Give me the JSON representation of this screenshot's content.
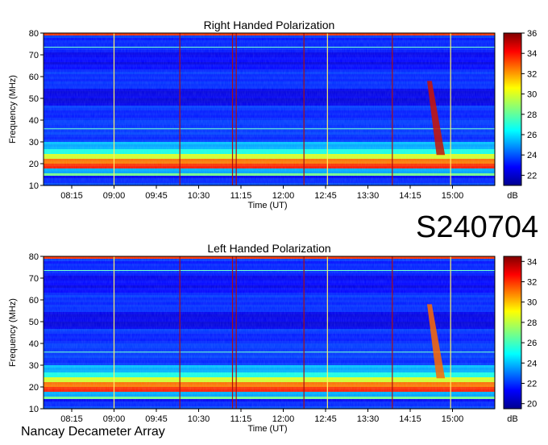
{
  "event_label": "S240704",
  "footer_label": "Nancay Decameter Array",
  "chart_data": [
    {
      "type": "heatmap",
      "title": "Right Handed Polarization",
      "xlabel": "Time (UT)",
      "ylabel": "Frequency (MHz)",
      "x_ticks": [
        "08:15",
        "09:00",
        "09:45",
        "10:30",
        "11:15",
        "12:00",
        "12:45",
        "13:30",
        "14:15",
        "15:00"
      ],
      "y_ticks": [
        10,
        20,
        30,
        40,
        50,
        60,
        70,
        80
      ],
      "ylim": [
        10,
        80
      ],
      "colorbar": {
        "label": "dB",
        "ticks": [
          22,
          24,
          26,
          28,
          30,
          32,
          34,
          36
        ],
        "range": [
          21,
          36
        ]
      },
      "colorscale": "jet"
    },
    {
      "type": "heatmap",
      "title": "Left Handed Polarization",
      "xlabel": "Time (UT)",
      "ylabel": "Frequency (MHz)",
      "x_ticks": [
        "08:15",
        "09:00",
        "09:45",
        "10:30",
        "11:15",
        "12:00",
        "12:45",
        "13:30",
        "14:15",
        "15:00"
      ],
      "y_ticks": [
        10,
        20,
        30,
        40,
        50,
        60,
        70,
        80
      ],
      "ylim": [
        10,
        80
      ],
      "colorbar": {
        "label": "dB",
        "ticks": [
          20,
          22,
          24,
          26,
          28,
          30,
          32,
          34
        ],
        "range": [
          19.5,
          34.5
        ]
      },
      "colorscale": "jet"
    }
  ]
}
